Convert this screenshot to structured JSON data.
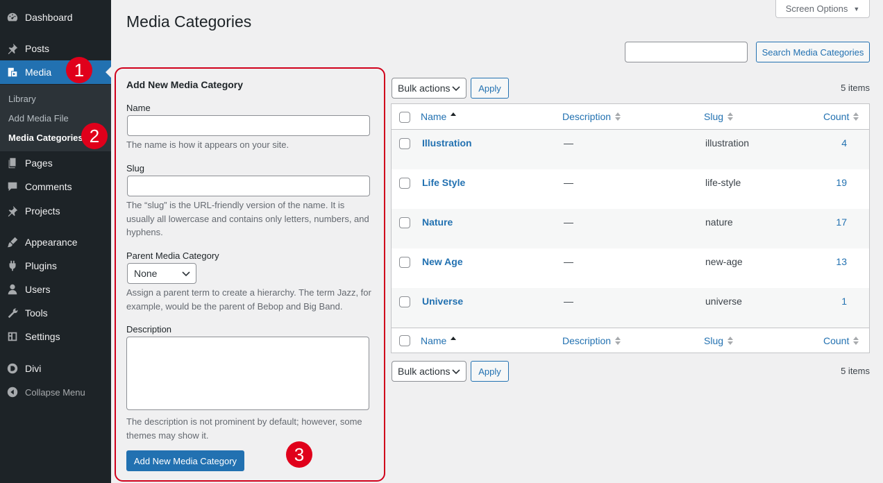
{
  "sidebar": {
    "items": [
      {
        "label": "Dashboard",
        "icon": "dashboard-icon"
      },
      {
        "label": "Posts",
        "icon": "pin-icon"
      },
      {
        "label": "Media",
        "icon": "media-icon"
      },
      {
        "label": "Pages",
        "icon": "pages-icon"
      },
      {
        "label": "Comments",
        "icon": "comments-icon"
      },
      {
        "label": "Projects",
        "icon": "pin-icon"
      },
      {
        "label": "Appearance",
        "icon": "brush-icon"
      },
      {
        "label": "Plugins",
        "icon": "plugin-icon"
      },
      {
        "label": "Users",
        "icon": "users-icon"
      },
      {
        "label": "Tools",
        "icon": "wrench-icon"
      },
      {
        "label": "Settings",
        "icon": "settings-icon"
      },
      {
        "label": "Divi",
        "icon": "divi-icon"
      },
      {
        "label": "Collapse Menu",
        "icon": "collapse-icon"
      }
    ],
    "submenu": [
      "Library",
      "Add Media File",
      "Media Categories"
    ],
    "active_item": "Media",
    "current_sub": "Media Categories"
  },
  "annotations": [
    "1",
    "2",
    "3"
  ],
  "header": {
    "screen_options": "Screen Options",
    "title": "Media Categories"
  },
  "search": {
    "button": "Search Media Categories",
    "value": ""
  },
  "form": {
    "heading": "Add New Media Category",
    "name_label": "Name",
    "name_help": "The name is how it appears on your site.",
    "slug_label": "Slug",
    "slug_help": "The “slug” is the URL-friendly version of the name. It is usually all lowercase and contains only letters, numbers, and hyphens.",
    "parent_label": "Parent Media Category",
    "parent_value": "None",
    "parent_help": "Assign a parent term to create a hierarchy. The term Jazz, for example, would be the parent of Bebop and Big Band.",
    "description_label": "Description",
    "description_help": "The description is not prominent by default; however, some themes may show it.",
    "submit": "Add New Media Category"
  },
  "table": {
    "bulk_actions": "Bulk actions",
    "apply": "Apply",
    "items_count": "5 items",
    "columns": [
      "Name",
      "Description",
      "Slug",
      "Count"
    ],
    "rows": [
      {
        "name": "Illustration",
        "description": "—",
        "slug": "illustration",
        "count": "4"
      },
      {
        "name": "Life Style",
        "description": "—",
        "slug": "life-style",
        "count": "19"
      },
      {
        "name": "Nature",
        "description": "—",
        "slug": "nature",
        "count": "17"
      },
      {
        "name": "New Age",
        "description": "—",
        "slug": "new-age",
        "count": "13"
      },
      {
        "name": "Universe",
        "description": "—",
        "slug": "universe",
        "count": "1"
      }
    ]
  },
  "colors": {
    "accent": "#2271b1",
    "sidebar_bg": "#1d2327",
    "annotation": "#e0001b"
  }
}
